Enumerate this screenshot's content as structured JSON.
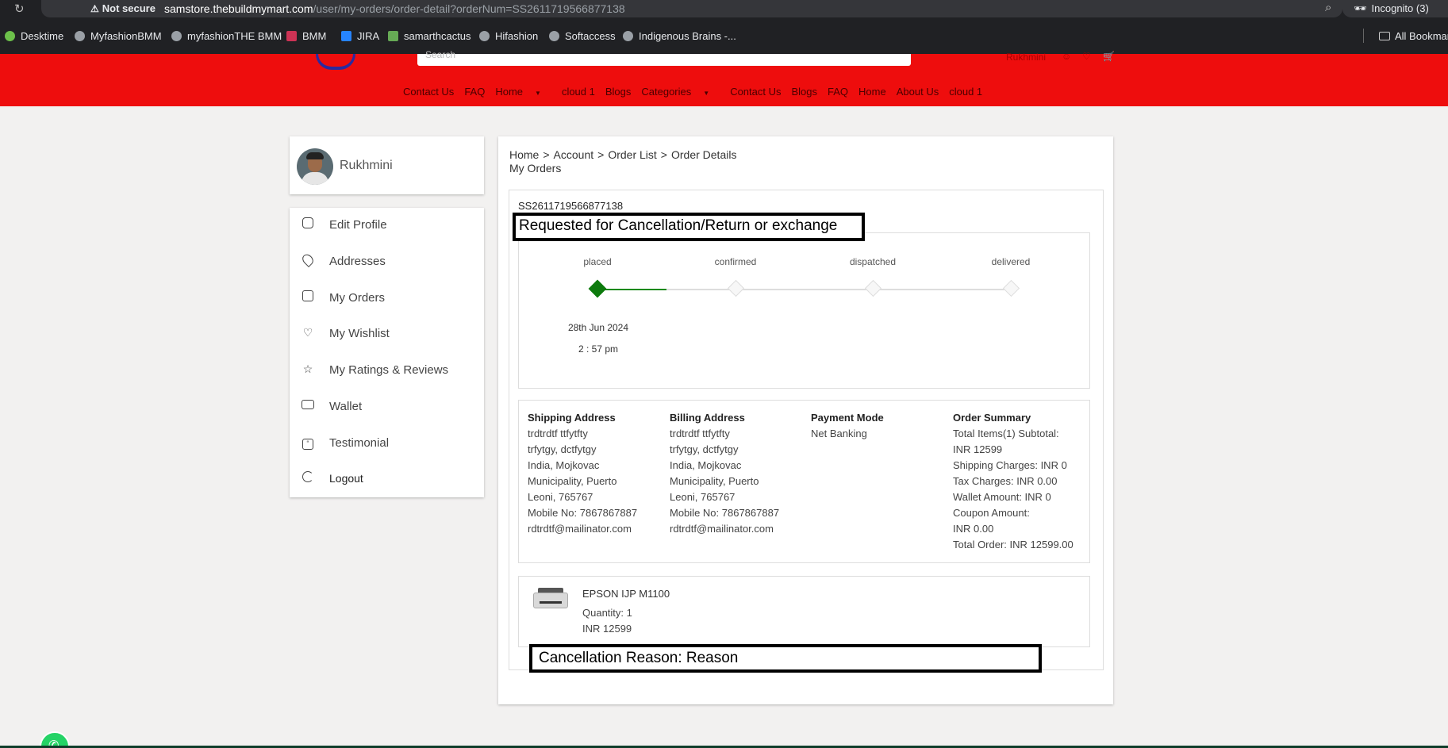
{
  "browser": {
    "security_label": "Not secure",
    "url_host": "samstore.thebuildmymart.com",
    "url_path": "/user/my-orders/order-detail?orderNum=SS2611719566877138",
    "incognito_label": "Incognito (3)",
    "bookmarks": [
      "Desktime",
      "MyfashionBMM",
      "myfashionTHE BMM",
      "BMM",
      "JIRA",
      "samarthcactus",
      "Hifashion",
      "Softaccess",
      "Indigenous Brains -..."
    ],
    "all_bookmarks_label": "All Bookmarks"
  },
  "header": {
    "search_placeholder": "Search",
    "user_name": "Rukhmini",
    "nav": [
      "Contact Us",
      "FAQ",
      "Home",
      "cloud 1",
      "Blogs",
      "Categories",
      "Contact Us",
      "Blogs",
      "FAQ",
      "Home",
      "About Us",
      "cloud 1"
    ],
    "brand_color": "#ee0d0d"
  },
  "sidebar": {
    "profile_name": "Rukhmini",
    "items": [
      {
        "label": "Edit Profile",
        "icon": "user-icon"
      },
      {
        "label": "Addresses",
        "icon": "location-icon"
      },
      {
        "label": "My Orders",
        "icon": "receipt-icon"
      },
      {
        "label": "My Wishlist",
        "icon": "heart-icon"
      },
      {
        "label": "My Ratings & Reviews",
        "icon": "star-icon"
      },
      {
        "label": "Wallet",
        "icon": "wallet-icon"
      },
      {
        "label": "Testimonial",
        "icon": "quote-icon"
      },
      {
        "label": "Logout",
        "icon": "logout-icon"
      }
    ]
  },
  "main": {
    "breadcrumb": [
      "Home",
      "Account",
      "Order List",
      "Order Details"
    ],
    "title": "My Orders",
    "order_number": "SS2611719566877138",
    "annotation_status": "Requested for Cancellation/Return or exchange",
    "tracker": {
      "steps": [
        "placed",
        "confirmed",
        "dispatched",
        "delivered"
      ],
      "active_step": "placed",
      "date": "28th Jun 2024",
      "time": "2 : 57 pm",
      "done_color": "#0d7a0d"
    },
    "shipping": {
      "heading": "Shipping Address",
      "lines": [
        "trdtrdtf ttfytfty",
        "trfytgy, dctfytgy",
        "India, Mojkovac",
        "Municipality, Puerto",
        "Leoni, 765767",
        "Mobile No: 7867867887",
        "rdtrdtf@mailinator.com"
      ]
    },
    "billing": {
      "heading": "Billing Address",
      "lines": [
        "trdtrdtf ttfytfty",
        "trfytgy, dctfytgy",
        "India, Mojkovac",
        "Municipality, Puerto",
        "Leoni, 765767",
        "Mobile No: 7867867887",
        "rdtrdtf@mailinator.com"
      ]
    },
    "payment": {
      "heading": "Payment Mode",
      "value": "Net Banking"
    },
    "summary": {
      "heading": "Order Summary",
      "lines": [
        "Total Items(1) Subtotal:",
        "INR 12599",
        "Shipping Charges: INR 0",
        "Tax Charges: INR 0.00",
        "Wallet Amount: INR 0",
        "Coupon Amount:",
        "INR 0.00",
        "Total Order: INR 12599.00"
      ]
    },
    "product": {
      "name": "EPSON IJP M1100",
      "quantity": "Quantity: 1",
      "price": "INR 12599"
    },
    "annotation_reason": "Cancellation Reason: Reason"
  }
}
